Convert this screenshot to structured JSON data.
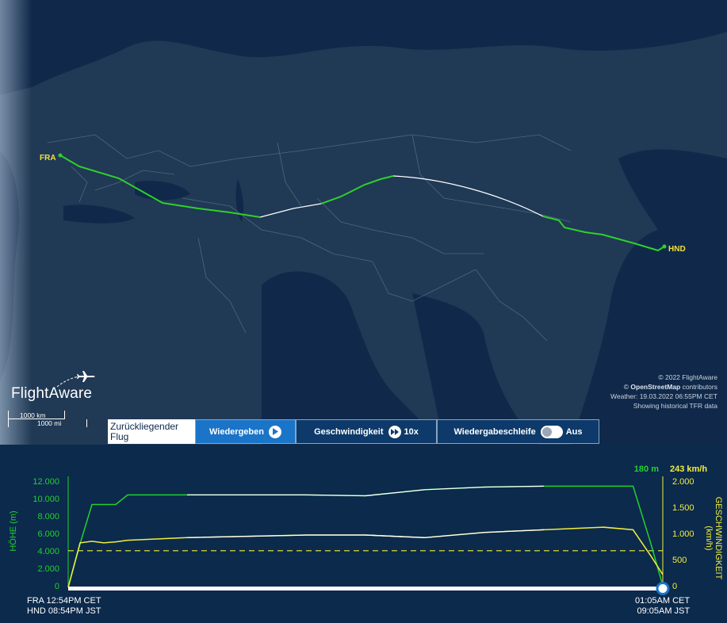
{
  "map": {
    "origin_code": "FRA",
    "destination_code": "HND",
    "logo_text": "FlightAware",
    "credits": {
      "copyright": "© 2022 FlightAware",
      "osm_prefix": "© ",
      "osm_name": "OpenStreetMap",
      "osm_suffix": " contributors",
      "weather": "Weather: 19.03.2022 06:55PM CET",
      "tfr": "Showing historical TFR data"
    },
    "scale": {
      "km": "1000 km",
      "mi": "1000 mi"
    }
  },
  "controls": {
    "label": "Zurückliegender Flug",
    "play": "Wiedergeben",
    "speed_label": "Geschwindigkeit",
    "speed_value": "10x",
    "loop_label": "Wiedergabeschleife",
    "loop_state": "Aus"
  },
  "graph": {
    "current_altitude": "180 m",
    "current_speed": "243 km/h",
    "altitude_axis_title": "HÖHE (m)",
    "speed_axis_title": "GESCHWINDIGKEIT (km/h)",
    "altitude_ticks": [
      "12.000",
      "10.000",
      "8.000",
      "6.000",
      "4.000",
      "2.000",
      "0"
    ],
    "speed_ticks": [
      "2.000",
      "1.500",
      "1.000",
      "500",
      "0"
    ],
    "start_time": {
      "origin": "FRA 12:54PM CET",
      "dest": "HND 08:54PM JST"
    },
    "end_time": {
      "origin": "01:05AM CET",
      "dest": "09:05AM JST"
    },
    "colors": {
      "altitude": "#22d12c",
      "speed": "#f2ef3a",
      "estimated": "#ffffff"
    }
  },
  "chart_data": {
    "type": "line",
    "x": [
      0,
      2,
      4,
      6,
      8,
      10,
      20,
      40,
      50,
      60,
      70,
      80,
      90,
      95,
      98,
      100
    ],
    "xlabel": "",
    "series": [
      {
        "name": "HÖHE (m)",
        "values": [
          0,
          5000,
          9500,
          9500,
          9500,
          10600,
          10600,
          10600,
          10500,
          11200,
          11500,
          11600,
          11600,
          11600,
          5000,
          180
        ]
      },
      {
        "name": "GESCHWINDIGKEIT (km/h)",
        "values": [
          0,
          850,
          880,
          850,
          870,
          900,
          950,
          1000,
          1000,
          950,
          1050,
          1100,
          1150,
          1100,
          600,
          243
        ]
      }
    ],
    "ylim_altitude": [
      0,
      12000
    ],
    "ylim_speed": [
      0,
      2000
    ]
  }
}
